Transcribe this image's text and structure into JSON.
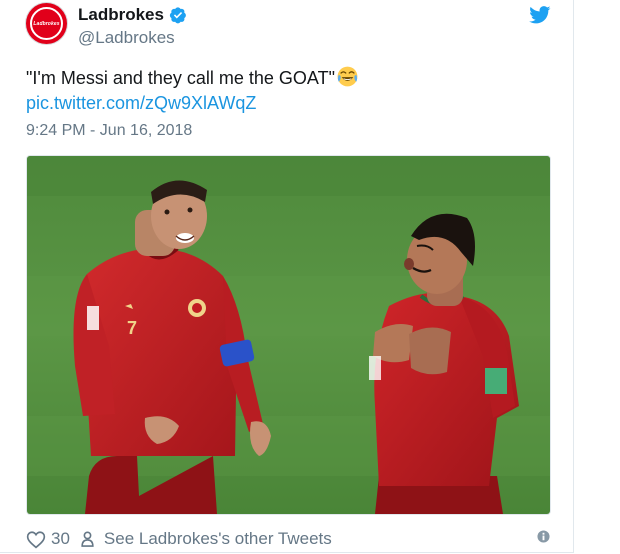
{
  "account": {
    "display_name": "Ladbrokes",
    "handle": "@Ladbrokes",
    "avatar_text": "Ladbrokes",
    "verified": true,
    "brand_color": "#e1001a"
  },
  "tweet": {
    "text": "\"I'm Messi and they call me the GOAT\"",
    "emoji": "face-with-tears-of-joy",
    "link": "pic.twitter.com/zQw9XlAWqZ",
    "timestamp": "9:24 PM - Jun 16, 2018",
    "link_color": "#1b95e0"
  },
  "photo": {
    "subject": "two-footballers-in-red-kits-on-pitch",
    "jersey_number": "7"
  },
  "footer": {
    "like_count": "30",
    "other_tweets_label": "See Ladbrokes's other Tweets"
  },
  "icons": {
    "verified": "verified-badge-icon",
    "twitter": "twitter-bird-icon",
    "like": "heart-icon",
    "profile": "person-icon",
    "info": "info-icon"
  }
}
